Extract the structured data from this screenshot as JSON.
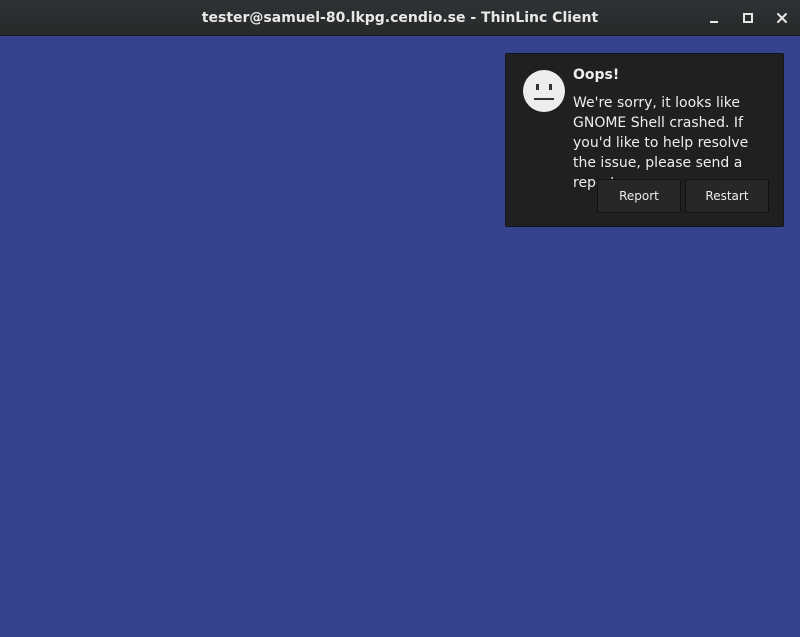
{
  "window": {
    "title": "tester@samuel-80.lkpg.cendio.se - ThinLinc Client",
    "controls": [
      "minimize-icon",
      "maximize-icon",
      "close-icon"
    ],
    "desktop_color": "#36428f"
  },
  "notification": {
    "icon": "sad-face-icon",
    "title": "Oops!",
    "message": "We're sorry, it looks like GNOME Shell crashed. If you'd like to help resolve the issue, please send a report.",
    "buttons": {
      "report_label": "Report",
      "restart_label": "Restart"
    },
    "background_color": "#1e2021"
  }
}
